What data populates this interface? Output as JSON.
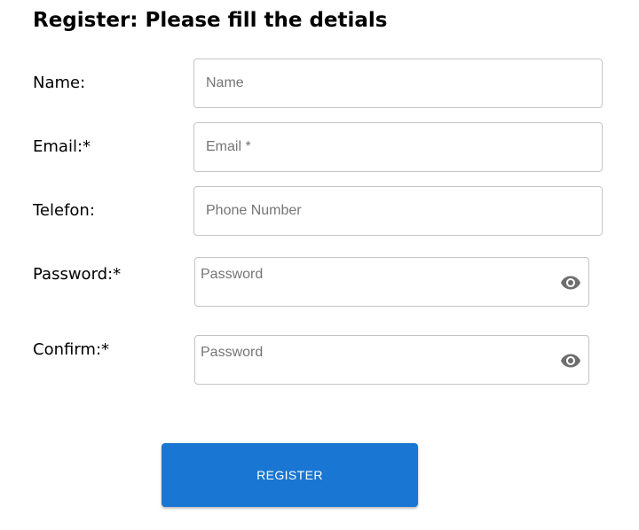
{
  "page": {
    "title": "Register: Please fill the detials"
  },
  "form": {
    "name": {
      "label": "Name:",
      "placeholder": "Name",
      "value": ""
    },
    "email": {
      "label": "Email:*",
      "placeholder": "Email *",
      "value": ""
    },
    "telefon": {
      "label": "Telefon:",
      "placeholder": "Phone Number",
      "value": ""
    },
    "password": {
      "label": "Password:*",
      "placeholder": "Password",
      "value": "",
      "toggle_icon": "eye-icon"
    },
    "confirm": {
      "label": "Confirm:*",
      "placeholder": "Password",
      "value": "",
      "toggle_icon": "eye-icon"
    },
    "submit_label": "REGISTER"
  },
  "colors": {
    "primary": "#1976d2",
    "input_border": "#c4c4c4",
    "placeholder": "#757575",
    "icon": "#6e6e6e"
  }
}
